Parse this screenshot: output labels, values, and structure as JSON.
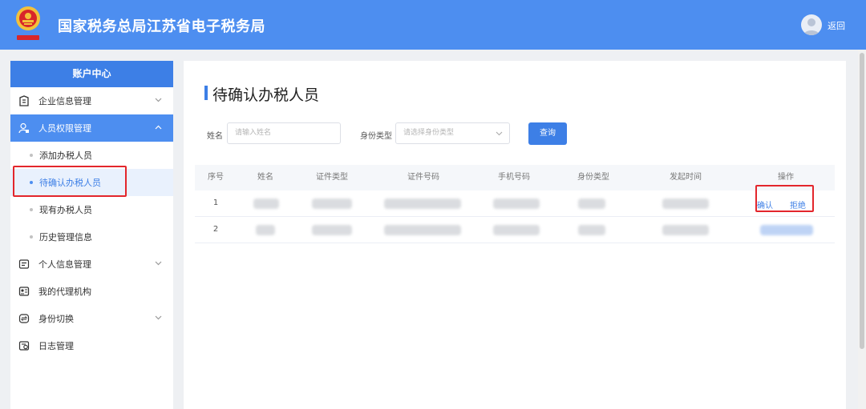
{
  "header": {
    "title": "国家税务总局江苏省电子税务局",
    "back_label": "返回"
  },
  "sidebar": {
    "heading": "账户中心",
    "items": [
      {
        "label": "企业信息管理",
        "icon": "building-icon",
        "has_children": true
      },
      {
        "label": "人员权限管理",
        "icon": "user-lock-icon",
        "has_children": true,
        "expanded": true
      },
      {
        "label": "个人信息管理",
        "icon": "id-card-icon",
        "has_children": true
      },
      {
        "label": "我的代理机构",
        "icon": "agency-icon",
        "has_children": false
      },
      {
        "label": "身份切换",
        "icon": "switch-icon",
        "has_children": true
      },
      {
        "label": "日志管理",
        "icon": "log-icon",
        "has_children": false
      }
    ],
    "subitems": [
      {
        "label": "添加办税人员"
      },
      {
        "label": "待确认办税人员",
        "current": true
      },
      {
        "label": "现有办税人员"
      },
      {
        "label": "历史管理信息"
      }
    ]
  },
  "main": {
    "title": "待确认办税人员",
    "filters": {
      "name_label": "姓名",
      "name_placeholder": "请输入姓名",
      "type_label": "身份类型",
      "type_placeholder": "请选择身份类型",
      "search_label": "查询"
    },
    "table": {
      "columns": [
        "序号",
        "姓名",
        "证件类型",
        "证件号码",
        "手机号码",
        "身份类型",
        "发起时间",
        "操作"
      ],
      "rows": [
        {
          "index": "1",
          "actions": [
            "确认",
            "拒绝"
          ]
        },
        {
          "index": "2",
          "actions": []
        }
      ]
    }
  },
  "colors": {
    "primary": "#3d7fe6",
    "header_bg": "#4d8ef0",
    "highlight": "#e3262c"
  }
}
